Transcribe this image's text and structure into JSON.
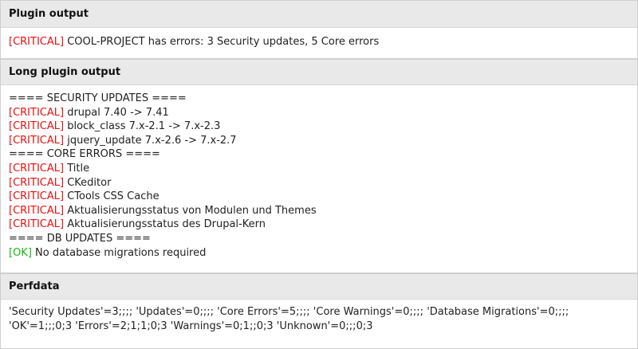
{
  "sections": {
    "plugin_output": {
      "title": "Plugin output",
      "line": {
        "tag": "[CRITICAL]",
        "text": " COOL-PROJECT has errors: 3 Security updates, 5 Core errors"
      }
    },
    "long_plugin_output": {
      "title": "Long plugin output",
      "lines": [
        {
          "tag": "",
          "text": "==== SECURITY UPDATES ===="
        },
        {
          "tag": "[CRITICAL]",
          "text": " drupal 7.40 -> 7.41"
        },
        {
          "tag": "[CRITICAL]",
          "text": " block_class 7.x-2.1 -> 7.x-2.3"
        },
        {
          "tag": "[CRITICAL]",
          "text": " jquery_update 7.x-2.6 -> 7.x-2.7"
        },
        {
          "tag": "",
          "text": "==== CORE ERRORS ===="
        },
        {
          "tag": "[CRITICAL]",
          "text": " Title"
        },
        {
          "tag": "[CRITICAL]",
          "text": " CKeditor"
        },
        {
          "tag": "[CRITICAL]",
          "text": " CTools CSS Cache"
        },
        {
          "tag": "[CRITICAL]",
          "text": " Aktualisierungsstatus von Modulen und Themes"
        },
        {
          "tag": "[CRITICAL]",
          "text": " Aktualisierungsstatus des Drupal-Kern"
        },
        {
          "tag": "",
          "text": "==== DB UPDATES ===="
        },
        {
          "tag": "[OK]",
          "text": " No database migrations required"
        }
      ]
    },
    "perfdata": {
      "title": "Perfdata",
      "lines": [
        "'Security Updates'=3;;;; 'Updates'=0;;;; 'Core Errors'=5;;;; 'Core Warnings'=0;;;; 'Database Migrations'=0;;;;",
        "'OK'=1;;;0;3 'Errors'=2;1;1;0;3 'Warnings'=0;1;;0;3 'Unknown'=0;;;0;3"
      ]
    }
  },
  "colors": {
    "critical": "#e81010",
    "ok": "#18b61a",
    "header_bg": "#e9e9e9"
  }
}
